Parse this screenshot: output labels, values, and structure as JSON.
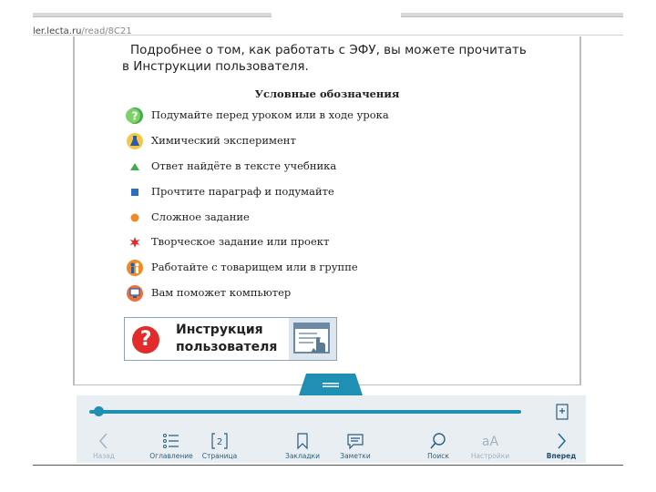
{
  "browser": {
    "url_host": "ler.lecta.ru",
    "url_path": "/read/8C21"
  },
  "page": {
    "intro_line1": "Подробнее о том, как работать с ЭФУ, вы можете прочитать",
    "intro_line2": "в Инструкции пользователя.",
    "legend_title": "Условные обозначения",
    "legend": [
      {
        "icon": "question-icon",
        "text": "Подумайте перед уроком или в ходе урока"
      },
      {
        "icon": "flask-icon",
        "text": "Химический эксперимент"
      },
      {
        "icon": "green-triangle-icon",
        "text": "Ответ найдёте в тексте учебника"
      },
      {
        "icon": "blue-square-icon",
        "text": "Прочтите параграф и подумайте"
      },
      {
        "icon": "orange-circle-icon",
        "text": "Сложное задание"
      },
      {
        "icon": "red-star-icon",
        "text": "Творческое задание или проект"
      },
      {
        "icon": "people-icon",
        "text": "Работайте с товарищем или в группе"
      },
      {
        "icon": "computer-icon",
        "text": "Вам поможет компьютер"
      }
    ],
    "help_button": {
      "line1": "Инструкция",
      "line2": "пользователя"
    }
  },
  "reader": {
    "progress": 0.02,
    "nav": [
      {
        "label": "Назад",
        "icon": "chevron-left-icon"
      },
      {
        "label": "Оглавление",
        "icon": "list-icon"
      },
      {
        "label": "Страница",
        "icon": "page-number-icon",
        "page_number": "2"
      },
      {
        "label": "Закладки",
        "icon": "bookmark-icon"
      },
      {
        "label": "Заметки",
        "icon": "notes-icon"
      },
      {
        "label": "Поиск",
        "icon": "search-icon"
      },
      {
        "label": "Настройки",
        "icon": "font-settings-icon",
        "glyph": "aA"
      },
      {
        "label": "Вперед",
        "icon": "chevron-right-icon"
      }
    ]
  },
  "colors": {
    "accent": "#1f8fb3",
    "green": "#3fae49",
    "blue": "#2a6fc2",
    "orange": "#f08a24",
    "red": "#e22b2b"
  }
}
